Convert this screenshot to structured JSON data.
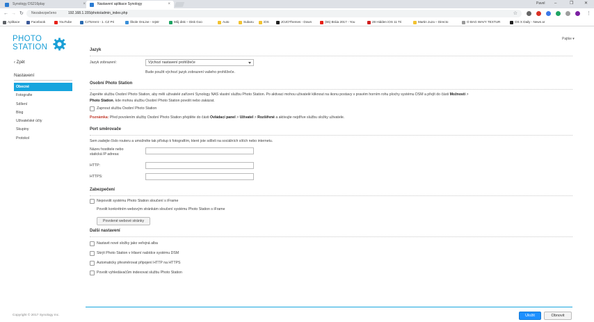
{
  "browser": {
    "tabs": [
      {
        "title": "Synology DS216play"
      },
      {
        "title": "Nastavení aplikace Synology"
      }
    ],
    "user": "Pavel",
    "address": {
      "security": "Nezabezpečeno",
      "url": "192.168.1.155/photo/admin_index.php"
    },
    "bookmarks": [
      {
        "label": "Aplikace",
        "color": "#5f6368"
      },
      {
        "label": "Facebook",
        "color": "#3b5998"
      },
      {
        "label": "YouTube",
        "color": "#e62117"
      },
      {
        "label": "CzTorrent - 1. CZ Pri",
        "color": "#2a6ab0"
      },
      {
        "label": "Škole OnLine - rejstr",
        "color": "#3a8fd8"
      },
      {
        "label": "Můj disk – Disk Goo",
        "color": "#1fa463"
      },
      {
        "label": "Auto",
        "color": "#f2c232"
      },
      {
        "label": "Subaru",
        "color": "#f2c232"
      },
      {
        "label": "iOS",
        "color": "#f2c232"
      },
      {
        "label": "JOJOThemes - Down",
        "color": "#222"
      },
      {
        "label": "(55) Bráia 2017 - You",
        "color": "#e62117"
      },
      {
        "label": "28 Hidden iOS 11 Tri",
        "color": "#d02020"
      },
      {
        "label": "Martin Juza – Directo",
        "color": "#f2c232"
      },
      {
        "label": "O BAG WAVY TEXTUR",
        "color": "#999"
      },
      {
        "label": "OS X Daily - News ar",
        "color": "#222"
      }
    ]
  },
  "app": {
    "logo_line1": "PHOTO",
    "logo_line2": "STATION",
    "user_menu": "Pajtke ▾",
    "back": "Zpět",
    "sidebar_title": "Nastavení",
    "sidebar_items": [
      "Obecné",
      "Fotografie",
      "Sdílení",
      "Blog",
      "Uživatelské účty",
      "Skupiny",
      "Protokol"
    ],
    "copyright": "Copyright © 2017 Synology Inc.",
    "language": {
      "title": "Jazyk",
      "label": "Jazyk zobrazení:",
      "value": "Výchozí nastavení prohlížeče",
      "hint": "Bude použit výchozí jazyk zobrazení vašeho prohlížeče."
    },
    "personal": {
      "title": "Osobní Photo Station",
      "p1a": "Zapněte službu Osobní Photo Station, aby měli uživatelé zařízení Synology NAS vlastní službu Photo Station. Po aktivaci mohou uživatelé kliknout na ikonu postavy v pravém horním rohu plochy systému DSM a přejít do části ",
      "p1b": "Možnosti",
      "p1c": " > ",
      "p2a": "Photo Station",
      "p2b": ", kde mohou službu Osobní Photo Station povolit nebo zakázat.",
      "checkbox": "Zapnout službu Osobní Photo Station",
      "note_label": "Poznámka:",
      "note_a": " Před povolením služby Osobní Photo Station přejděte do části ",
      "note_b": "Ovládací panel",
      "note_c": " > ",
      "note_d": "Uživatel",
      "note_e": " > ",
      "note_f": "Rozšířené",
      "note_g": " a aktivujte nejdříve službu složky uživatele."
    },
    "router": {
      "title": "Port směrovače",
      "desc": "Sem zadejte číslo routeru a umožněte tak přístup k fotografiím, které jste sdíleli na sociálních sítích nebo internetu.",
      "host_label_1": "Název hostitele nebo",
      "host_label_2": "statická IP adresa:",
      "http_label": "HTTP:",
      "https_label": "HTTPS:"
    },
    "security": {
      "title": "Zabezpečení",
      "checkbox": "Nepovolit systému Photo Station sloučení s iFrame",
      "hint": "Povolit konkrétním webovým stránkám sloučení systému Photo Station s iFrame",
      "button": "Povolené webové stránky"
    },
    "other": {
      "title": "Další nastavení",
      "items": [
        "Nastavit nové složky jako veřejná alba",
        "Skrýt Photo Station v Hlavní nabídce systému DSM",
        "Automaticky přesměrovat připojení HTTP na HTTPS",
        "Povolit vyhledávačům indexovat službu Photo Station"
      ]
    },
    "save_button": "Uložit",
    "reset_button": "Obnovit"
  }
}
